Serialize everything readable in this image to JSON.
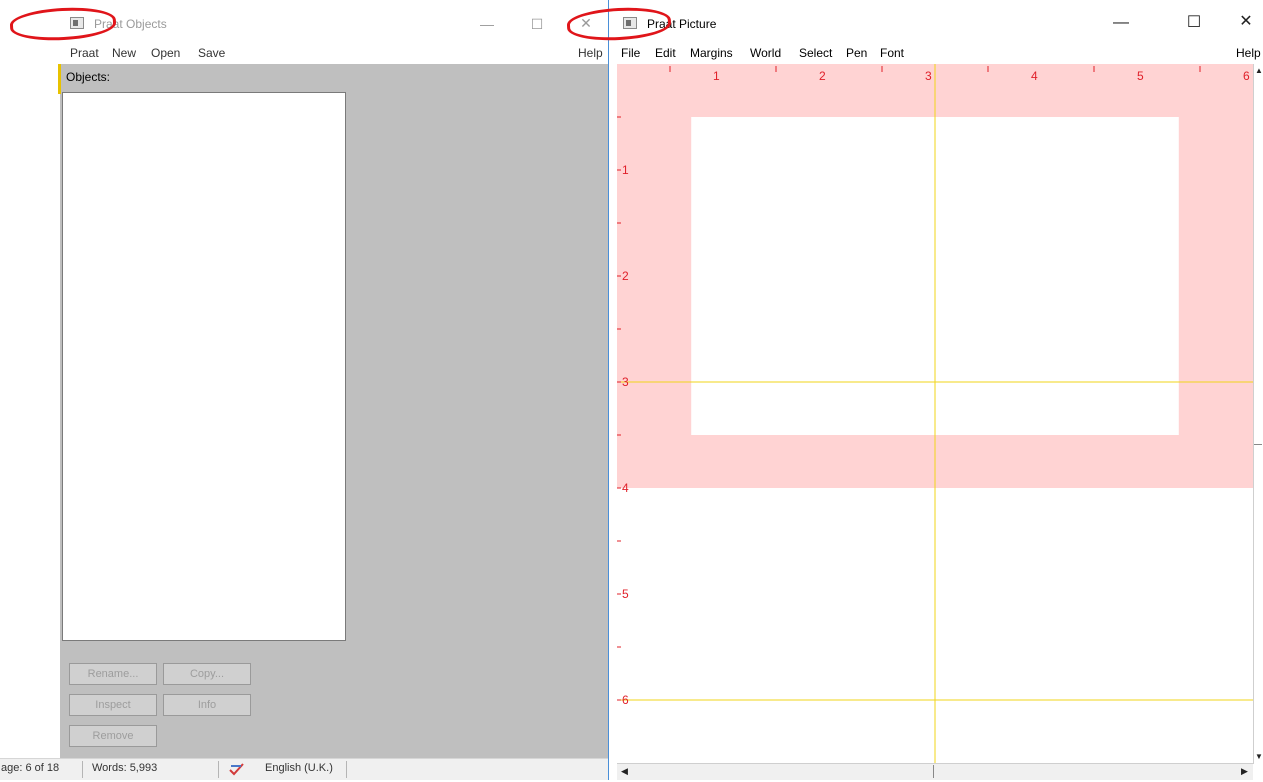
{
  "objects_window": {
    "title": "Praat Objects",
    "window_buttons": {
      "minimize": "—",
      "maximize": "☐",
      "close": "✕"
    },
    "menu": [
      "Praat",
      "New",
      "Open",
      "Save"
    ],
    "help": "Help",
    "objects_label": "Objects:",
    "buttons": {
      "rename": "Rename...",
      "copy": "Copy...",
      "inspect": "Inspect",
      "info": "Info",
      "remove": "Remove"
    }
  },
  "picture_window": {
    "title": "Praat Picture",
    "window_buttons": {
      "minimize": "—",
      "maximize": "☐",
      "close": "✕"
    },
    "menu": [
      "File",
      "Edit",
      "Margins",
      "World",
      "Select",
      "Pen",
      "Font"
    ],
    "help": "Help",
    "canvas": {
      "ruler_top_labels": [
        "1",
        "2",
        "3",
        "4",
        "5",
        "6"
      ],
      "ruler_left_labels": [
        "1",
        "2",
        "3",
        "4",
        "5",
        "6"
      ],
      "viewport_inches": {
        "x": [
          0,
          6
        ],
        "y": [
          0,
          4
        ]
      },
      "inner_area_inches": {
        "x": [
          0.7,
          5.3
        ],
        "y": [
          0.5,
          3.5
        ]
      },
      "yellow_lines_inches": {
        "vertical": [
          3
        ],
        "horizontal": [
          3,
          6
        ]
      },
      "colors": {
        "margin_pink": "#ffd3d3",
        "ruler_red": "#e0202a",
        "guide_yellow": "#f2d41a"
      }
    }
  },
  "statusbar": {
    "page": "age: 6 of 18",
    "words": "Words: 5,993",
    "language": "English (U.K.)",
    "spellcheck_icon": "spellcheck-icon"
  },
  "annotation_color": "#e0151a"
}
